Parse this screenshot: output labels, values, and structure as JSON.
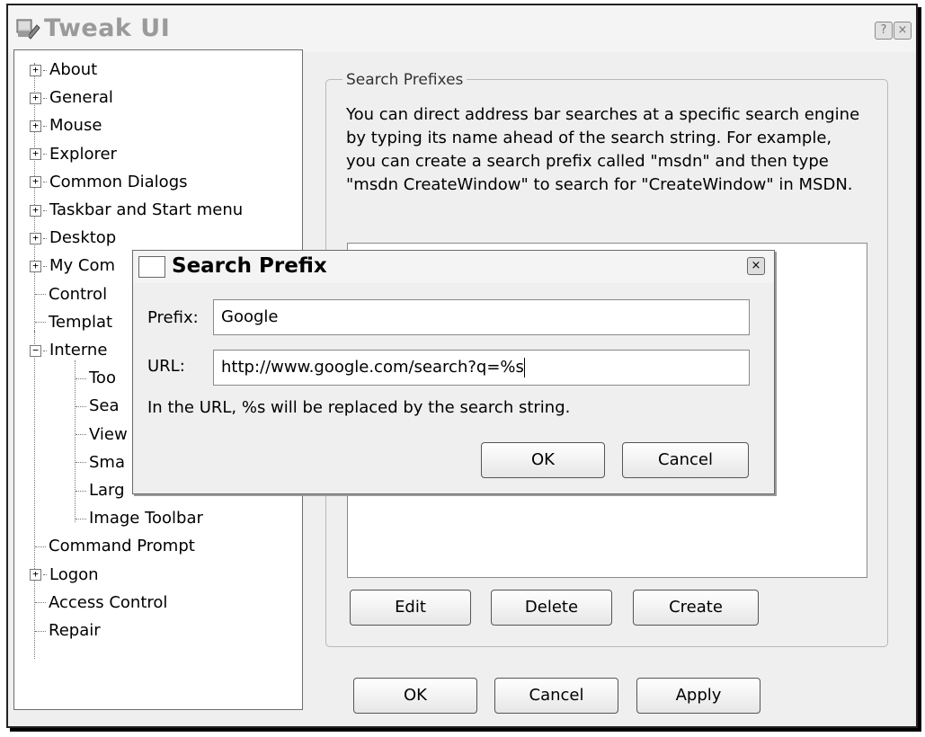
{
  "window": {
    "title": "Tweak UI",
    "help_label": "?",
    "close_label": "×"
  },
  "tree": {
    "items": [
      {
        "label": "About",
        "expander": "+"
      },
      {
        "label": "General",
        "expander": "+"
      },
      {
        "label": "Mouse",
        "expander": "+"
      },
      {
        "label": "Explorer",
        "expander": "+"
      },
      {
        "label": "Common Dialogs",
        "expander": "+"
      },
      {
        "label": "Taskbar and Start menu",
        "expander": "+"
      },
      {
        "label": "Desktop",
        "expander": "+"
      },
      {
        "label": "My Com",
        "expander": "+"
      },
      {
        "label": "Control",
        "expander": ""
      },
      {
        "label": "Templat",
        "expander": ""
      },
      {
        "label": "Interne",
        "expander": "−"
      },
      {
        "label": "Too",
        "expander": ""
      },
      {
        "label": "Sea",
        "expander": ""
      },
      {
        "label": "View",
        "expander": ""
      },
      {
        "label": "Sma",
        "expander": ""
      },
      {
        "label": "Larg",
        "expander": ""
      },
      {
        "label": "Image Toolbar",
        "expander": ""
      },
      {
        "label": "Command Prompt",
        "expander": ""
      },
      {
        "label": "Logon",
        "expander": "+"
      },
      {
        "label": "Access Control",
        "expander": ""
      },
      {
        "label": "Repair",
        "expander": ""
      }
    ]
  },
  "panel": {
    "group_title": "Search Prefixes",
    "description": "You can direct address bar searches at a specific search engine by typing its name ahead of the search string. For example, you can create a search prefix called \"msdn\" and then type \"msdn CreateWindow\" to search for \"CreateWindow\" in MSDN.",
    "edit_label": "Edit",
    "delete_label": "Delete",
    "create_label": "Create"
  },
  "footer": {
    "ok_label": "OK",
    "cancel_label": "Cancel",
    "apply_label": "Apply"
  },
  "dialog": {
    "title": "Search Prefix",
    "close_label": "×",
    "prefix_label": "Prefix:",
    "prefix_value": "Google",
    "url_label": "URL:",
    "url_value": "http://www.google.com/search?q=%s",
    "hint": "In the URL, %s will be replaced by the search string.",
    "ok_label": "OK",
    "cancel_label": "Cancel"
  }
}
